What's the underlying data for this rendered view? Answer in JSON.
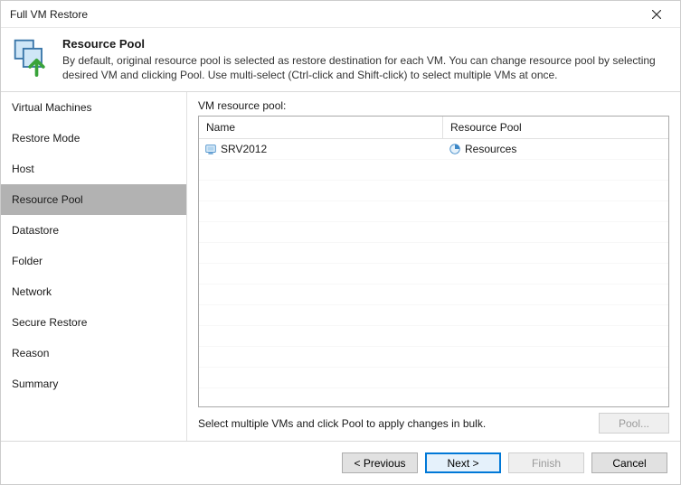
{
  "window": {
    "title": "Full VM Restore"
  },
  "header": {
    "heading": "Resource Pool",
    "description": "By default, original resource pool is selected as restore destination for each VM. You can change resource pool by selecting desired VM and clicking Pool. Use multi-select (Ctrl-click and Shift-click) to select multiple VMs at once."
  },
  "sidebar": {
    "items": [
      {
        "label": "Virtual Machines",
        "selected": false
      },
      {
        "label": "Restore Mode",
        "selected": false
      },
      {
        "label": "Host",
        "selected": false
      },
      {
        "label": "Resource Pool",
        "selected": true
      },
      {
        "label": "Datastore",
        "selected": false
      },
      {
        "label": "Folder",
        "selected": false
      },
      {
        "label": "Network",
        "selected": false
      },
      {
        "label": "Secure Restore",
        "selected": false
      },
      {
        "label": "Reason",
        "selected": false
      },
      {
        "label": "Summary",
        "selected": false
      }
    ]
  },
  "main": {
    "label": "VM resource pool:",
    "columns": {
      "name": "Name",
      "pool": "Resource Pool"
    },
    "rows": [
      {
        "name": "SRV2012",
        "pool": "Resources"
      }
    ],
    "hint": "Select multiple VMs and click Pool to apply changes in bulk.",
    "pool_button": "Pool..."
  },
  "footer": {
    "previous": "< Previous",
    "next": "Next >",
    "finish": "Finish",
    "cancel": "Cancel"
  }
}
